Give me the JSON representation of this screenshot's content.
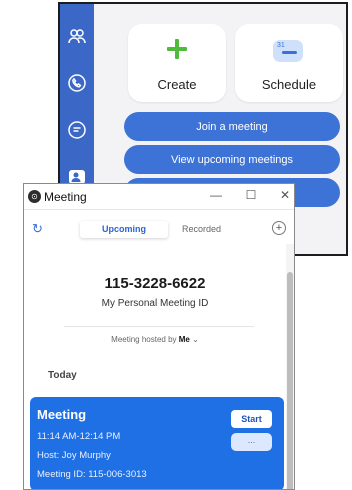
{
  "background_app": {
    "tiles": [
      {
        "label": "Create",
        "icon": "plus-icon"
      },
      {
        "label": "Schedule",
        "icon": "calendar-icon",
        "calendar_day": "31"
      }
    ],
    "buttons": [
      "Join a meeting",
      "View upcoming meetings"
    ],
    "sidebar_icons": [
      "contacts-icon",
      "phone-icon",
      "chat-icon",
      "meetings-icon"
    ],
    "accent_color": "#3d73d6"
  },
  "meeting_window": {
    "title": "Meeting",
    "controls": {
      "minimize": "—",
      "maximize": "☐",
      "close": "✕"
    },
    "tabs": [
      {
        "label": "Upcoming",
        "active": true
      },
      {
        "label": "Recorded",
        "active": false
      }
    ],
    "personal_meeting": {
      "id": "115-3228-6622",
      "label": "My Personal Meeting ID",
      "hosted_by_prefix": "Meeting hosted by",
      "hosted_by_value": "Me"
    },
    "section_label": "Today",
    "meeting_card": {
      "title": "Meeting",
      "time": "11:14 AM-12:14 PM",
      "host": "Host: Joy Murphy",
      "meeting_id": "Meeting ID: 115-006-3013",
      "start_label": "Start",
      "more_label": "..."
    },
    "card_color": "#1f6fe5"
  }
}
